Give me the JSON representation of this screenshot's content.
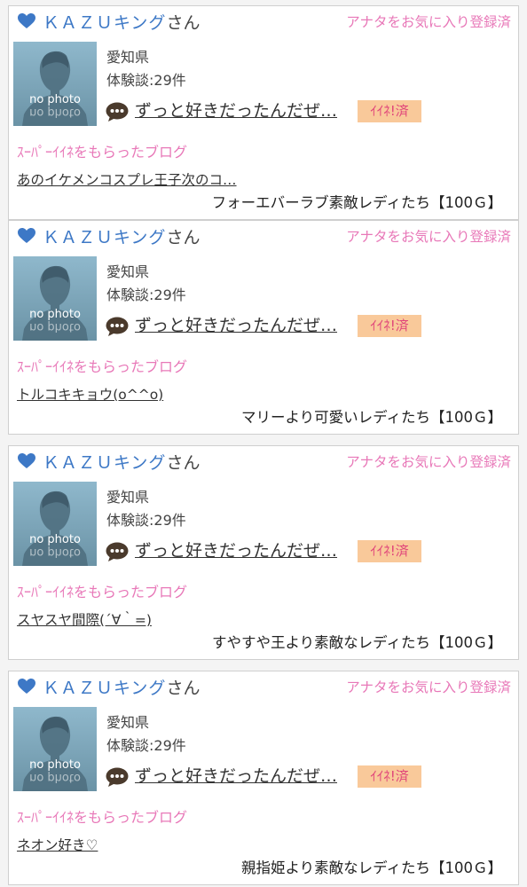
{
  "cards": [
    {
      "user_name": "ＫＡＺＵキング",
      "honorific": "さん",
      "favorite_status": "アナタをお気に入り登録済",
      "avatar_text": "no photo",
      "prefecture": "愛知県",
      "reviews": "体験談:29件",
      "blog_title": "ずっと好きだったんだぜ…",
      "like_badge": "ｲｲﾈ!済",
      "super_like_label": "ｽｰﾊﾟｰｲｲﾈをもらったブログ",
      "blog_link": "あのイケメンコスプレ王子次のコ…",
      "lady_info": "フォーエバーラブ素敵レディたち【100Ｇ】"
    },
    {
      "user_name": "ＫＡＺＵキング",
      "honorific": "さん",
      "favorite_status": "アナタをお気に入り登録済",
      "avatar_text": "no photo",
      "prefecture": "愛知県",
      "reviews": "体験談:29件",
      "blog_title": "ずっと好きだったんだぜ…",
      "like_badge": "ｲｲﾈ!済",
      "super_like_label": "ｽｰﾊﾟｰｲｲﾈをもらったブログ",
      "blog_link": "トルコキキョウ(o^^o)",
      "lady_info": "マリーより可愛いレディたち【100Ｇ】"
    },
    {
      "user_name": "ＫＡＺＵキング",
      "honorific": "さん",
      "favorite_status": "アナタをお気に入り登録済",
      "avatar_text": "no photo",
      "prefecture": "愛知県",
      "reviews": "体験談:29件",
      "blog_title": "ずっと好きだったんだぜ…",
      "like_badge": "ｲｲﾈ!済",
      "super_like_label": "ｽｰﾊﾟｰｲｲﾈをもらったブログ",
      "blog_link": "スヤスヤ間際(´∀｀=)",
      "lady_info": "すやすや王より素敵なレディたち【100Ｇ】"
    },
    {
      "user_name": "ＫＡＺＵキング",
      "honorific": "さん",
      "favorite_status": "アナタをお気に入り登録済",
      "avatar_text": "no photo",
      "prefecture": "愛知県",
      "reviews": "体験談:29件",
      "blog_title": "ずっと好きだったんだぜ…",
      "like_badge": "ｲｲﾈ!済",
      "super_like_label": "ｽｰﾊﾟｰｲｲﾈをもらったブログ",
      "blog_link": "ネオン好き♡",
      "lady_info": "親指姫より素敵なレディたち【100Ｇ】"
    }
  ],
  "icons": {
    "heart": "heart-icon",
    "speech": "speech-bubble-icon",
    "avatar": "avatar-placeholder"
  },
  "colors": {
    "user_name": "#3d78c6",
    "pink_text": "#e878b8",
    "badge_bg": "#f9c99a",
    "badge_text": "#e0447a"
  }
}
